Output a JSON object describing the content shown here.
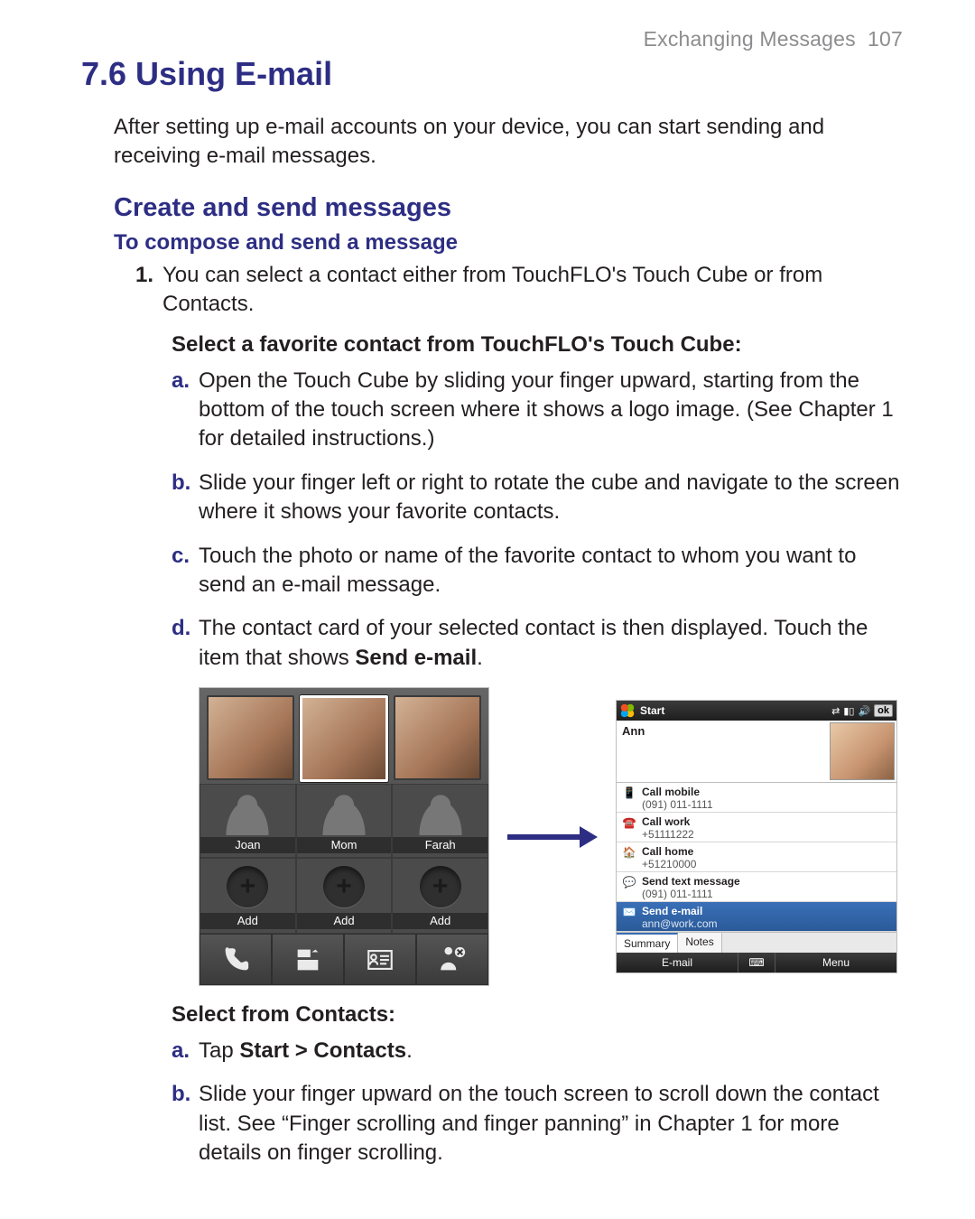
{
  "runningHead": {
    "chapter": "Exchanging Messages",
    "page": "107"
  },
  "h1": "7.6 Using E-mail",
  "intro": "After setting up e-mail accounts on your device, you can start sending and receiving e-mail messages.",
  "h2": "Create and send messages",
  "h3": "To compose and send a message",
  "step1": {
    "num": "1.",
    "text": "You can select a contact either from TouchFLO's Touch Cube or from Contacts."
  },
  "cubeLead": "Select a favorite contact from TouchFLO's Touch Cube:",
  "cubeSteps": {
    "a": {
      "alpha": "a.",
      "text": "Open the Touch Cube by sliding your finger upward, starting from the bottom of the touch screen where it shows a logo image. (See Chapter 1 for detailed instructions.)"
    },
    "b": {
      "alpha": "b.",
      "text": "Slide your finger left or right to rotate the cube and navigate to the screen where it shows your favorite contacts."
    },
    "c": {
      "alpha": "c.",
      "text": "Touch the photo or name of the favorite contact to whom you want to send an e-mail message."
    },
    "d": {
      "alpha": "d.",
      "pre": "The contact card of your selected contact is then displayed. Touch the item that shows ",
      "boldTail": "Send e-mail",
      "post": "."
    }
  },
  "cubeFig": {
    "names": {
      "n0": "Joan",
      "n1": "Mom",
      "n2": "Farah"
    },
    "add": "Add"
  },
  "wmFig": {
    "titlebar": {
      "start": "Start",
      "ok": "ok"
    },
    "contactName": "Ann",
    "rows": {
      "r0": {
        "t1": "Call mobile",
        "t2": "(091) 011-1111"
      },
      "r1": {
        "t1": "Call work",
        "t2": "+51111222"
      },
      "r2": {
        "t1": "Call home",
        "t2": "+51210000"
      },
      "r3": {
        "t1": "Send text message",
        "t2": "(091) 011-1111"
      },
      "r4": {
        "t1": "Send e-mail",
        "t2": "ann@work.com"
      }
    },
    "tabs": {
      "summary": "Summary",
      "notes": "Notes"
    },
    "softkeys": {
      "left": "E-mail",
      "right": "Menu"
    }
  },
  "contactsLead": "Select from Contacts:",
  "contactsSteps": {
    "a": {
      "alpha": "a.",
      "pre": "Tap ",
      "bold": "Start > Contacts",
      "post": "."
    },
    "b": {
      "alpha": "b.",
      "text": "Slide your finger upward on the touch screen to scroll down the contact list. See “Finger scrolling and finger panning” in Chapter 1 for more details on finger scrolling."
    }
  }
}
